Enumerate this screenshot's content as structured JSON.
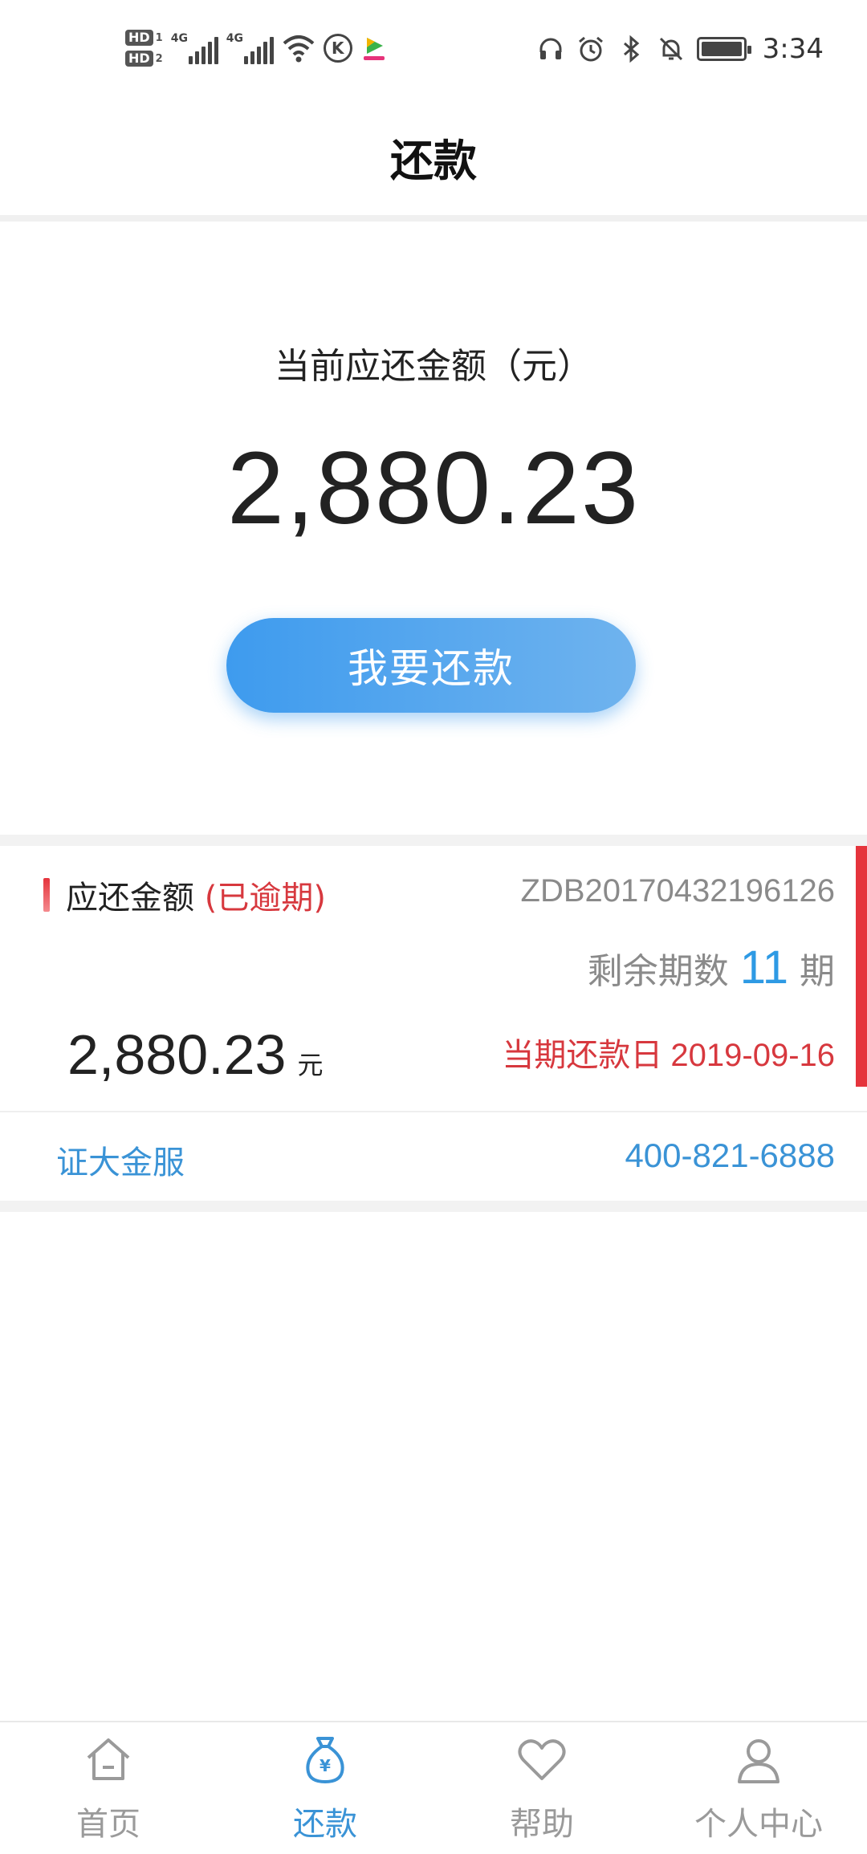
{
  "status_bar": {
    "hd1": "HD",
    "hd1_sub": "1",
    "hd2": "HD",
    "hd2_sub": "2",
    "net1": "4G",
    "net2": "4G",
    "k_icon": "K",
    "time": "3:34"
  },
  "header": {
    "title": "还款"
  },
  "summary": {
    "label": "当前应还金额（元）",
    "amount": "2,880.23",
    "button_label": "我要还款"
  },
  "loan_card": {
    "title": "应还金额",
    "overdue_tag": "(已逾期)",
    "contract_no": "ZDB20170432196126",
    "remaining_label": "剩余期数",
    "remaining_count": "11",
    "remaining_unit": "期",
    "amount": "2,880.23",
    "amount_unit": "元",
    "due_label": "当期还款日",
    "due_date": "2019-09-16",
    "company": "证大金服",
    "phone": "400-821-6888",
    "accent_color": "#e5343c"
  },
  "tabbar": {
    "items": [
      {
        "label": "首页",
        "icon": "home-icon",
        "active": false
      },
      {
        "label": "还款",
        "icon": "money-bag-icon",
        "active": true
      },
      {
        "label": "帮助",
        "icon": "heart-icon",
        "active": false
      },
      {
        "label": "个人中心",
        "icon": "user-icon",
        "active": false
      }
    ],
    "active_color": "#3a93d6",
    "inactive_color": "#9a9a9a"
  }
}
